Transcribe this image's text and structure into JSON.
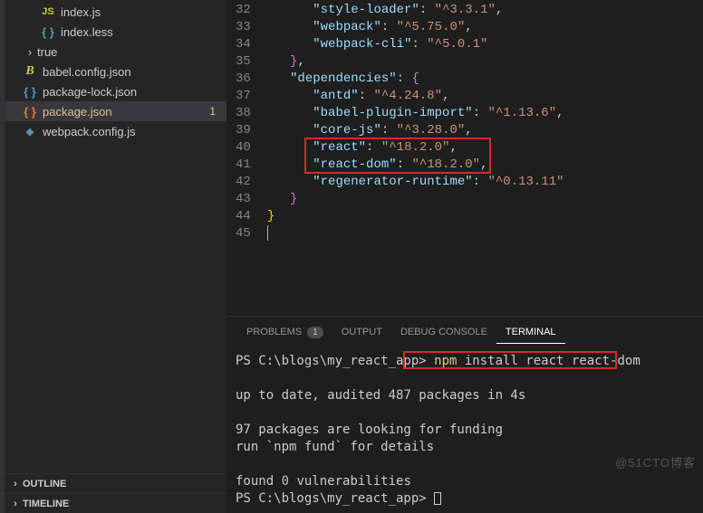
{
  "explorer": {
    "items": [
      {
        "indent": 32,
        "icon": "js",
        "label": "index.js",
        "gitM": false
      },
      {
        "indent": 32,
        "icon": "brace",
        "label": "index.less",
        "gitM": false
      },
      {
        "indent": 12,
        "twisty": ">",
        "icon": "",
        "label": "true",
        "gitM": false
      },
      {
        "indent": 12,
        "icon": "babel",
        "label": "babel.config.json",
        "gitM": false
      },
      {
        "indent": 12,
        "icon": "brace",
        "label": "package-lock.json",
        "gitM": false
      },
      {
        "indent": 12,
        "icon": "brace-sel",
        "label": "package.json",
        "gitM": true,
        "selected": true,
        "badge": "1"
      },
      {
        "indent": 12,
        "icon": "webpack",
        "label": "webpack.config.js",
        "gitM": false
      }
    ],
    "outline": "OUTLINE",
    "timeline": "TIMELINE"
  },
  "editor": {
    "startLine": 32,
    "lines": [
      [
        {
          "t": "      ",
          "c": ""
        },
        {
          "t": "\"style-loader\"",
          "c": "s-key"
        },
        {
          "t": ": ",
          "c": "s-punc"
        },
        {
          "t": "\"^3.3.1\"",
          "c": "s-str"
        },
        {
          "t": ",",
          "c": "s-punc"
        }
      ],
      [
        {
          "t": "      ",
          "c": ""
        },
        {
          "t": "\"webpack\"",
          "c": "s-key"
        },
        {
          "t": ": ",
          "c": "s-punc"
        },
        {
          "t": "\"^5.75.0\"",
          "c": "s-str"
        },
        {
          "t": ",",
          "c": "s-punc"
        }
      ],
      [
        {
          "t": "      ",
          "c": ""
        },
        {
          "t": "\"webpack-cli\"",
          "c": "s-key"
        },
        {
          "t": ": ",
          "c": "s-punc"
        },
        {
          "t": "\"^5.0.1\"",
          "c": "s-str"
        }
      ],
      [
        {
          "t": "   ",
          "c": ""
        },
        {
          "t": "}",
          "c": "s-brace2"
        },
        {
          "t": ",",
          "c": "s-punc"
        }
      ],
      [
        {
          "t": "   ",
          "c": ""
        },
        {
          "t": "\"dependencies\"",
          "c": "s-key"
        },
        {
          "t": ": ",
          "c": "s-punc"
        },
        {
          "t": "{",
          "c": "s-brace2"
        }
      ],
      [
        {
          "t": "      ",
          "c": ""
        },
        {
          "t": "\"antd\"",
          "c": "s-key"
        },
        {
          "t": ": ",
          "c": "s-punc"
        },
        {
          "t": "\"^4.24.8\"",
          "c": "s-str"
        },
        {
          "t": ",",
          "c": "s-punc"
        }
      ],
      [
        {
          "t": "      ",
          "c": ""
        },
        {
          "t": "\"babel-plugin-import\"",
          "c": "s-key"
        },
        {
          "t": ": ",
          "c": "s-punc"
        },
        {
          "t": "\"^1.13.6\"",
          "c": "s-str"
        },
        {
          "t": ",",
          "c": "s-punc"
        }
      ],
      [
        {
          "t": "      ",
          "c": ""
        },
        {
          "t": "\"core-js\"",
          "c": "s-key"
        },
        {
          "t": ": ",
          "c": "s-punc"
        },
        {
          "t": "\"^3.28.0\"",
          "c": "s-str"
        },
        {
          "t": ",",
          "c": "s-punc"
        }
      ],
      [
        {
          "t": "      ",
          "c": ""
        },
        {
          "t": "\"react\"",
          "c": "s-key"
        },
        {
          "t": ": ",
          "c": "s-punc"
        },
        {
          "t": "\"^18.2.0\"",
          "c": "s-str"
        },
        {
          "t": ",",
          "c": "s-punc"
        }
      ],
      [
        {
          "t": "      ",
          "c": ""
        },
        {
          "t": "\"react-dom\"",
          "c": "s-key"
        },
        {
          "t": ": ",
          "c": "s-punc"
        },
        {
          "t": "\"^18.2.0\"",
          "c": "s-str"
        },
        {
          "t": ",",
          "c": "s-punc"
        }
      ],
      [
        {
          "t": "      ",
          "c": ""
        },
        {
          "t": "\"regenerator-runtime\"",
          "c": "s-key"
        },
        {
          "t": ": ",
          "c": "s-punc"
        },
        {
          "t": "\"^0.13.11\"",
          "c": "s-str"
        }
      ],
      [
        {
          "t": "   ",
          "c": ""
        },
        {
          "t": "}",
          "c": "s-brace2"
        }
      ],
      [
        {
          "t": "}",
          "c": "s-brace"
        }
      ],
      [
        {
          "t": "",
          "c": "",
          "cursor": true
        }
      ]
    ]
  },
  "panel": {
    "tabs": {
      "problems": "PROBLEMS",
      "problemsCount": "1",
      "output": "OUTPUT",
      "debug": "DEBUG CONSOLE",
      "terminal": "TERMINAL"
    },
    "terminal": {
      "line1_path": "PS C:\\blogs\\my_react_app> ",
      "line1_cmd_kw": "npm",
      "line1_cmd_rest": " install react react-dom",
      "blank": "",
      "line2": "up to date, audited 487 packages in 4s",
      "line3": "97 packages are looking for funding",
      "line4": "  run `npm fund` for details",
      "line5a": "found ",
      "line5b": "0",
      "line5c": " vulnerabilities",
      "line6": "PS C:\\blogs\\my_react_app> "
    }
  },
  "watermark": "@51CTO博客"
}
